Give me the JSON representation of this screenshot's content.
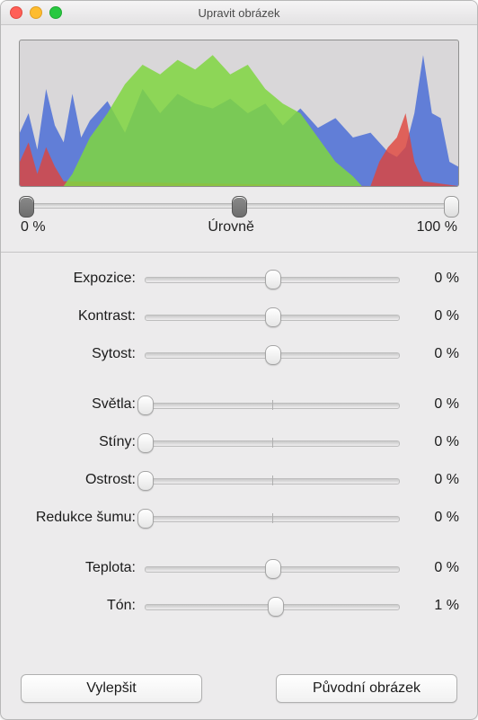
{
  "window": {
    "title": "Upravit obrázek"
  },
  "levels": {
    "left_label": "0 %",
    "center_label": "Úrovně",
    "right_label": "100 %"
  },
  "group1": [
    {
      "label": "Expozice:",
      "value": "0 %",
      "pos": 50,
      "type": "center"
    },
    {
      "label": "Kontrast:",
      "value": "0 %",
      "pos": 50,
      "type": "center"
    },
    {
      "label": "Sytost:",
      "value": "0 %",
      "pos": 50,
      "type": "center"
    }
  ],
  "group2": [
    {
      "label": "Světla:",
      "value": "0 %",
      "pos": 0,
      "type": "left"
    },
    {
      "label": "Stíny:",
      "value": "0 %",
      "pos": 0,
      "type": "left"
    },
    {
      "label": "Ostrost:",
      "value": "0 %",
      "pos": 0,
      "type": "left"
    },
    {
      "label": "Redukce šumu:",
      "value": "0 %",
      "pos": 0,
      "type": "left"
    }
  ],
  "group3": [
    {
      "label": "Teplota:",
      "value": "0 %",
      "pos": 50,
      "type": "center"
    },
    {
      "label": "Tón:",
      "value": "1 %",
      "pos": 51,
      "type": "center"
    }
  ],
  "buttons": {
    "enhance": "Vylepšit",
    "reset": "Původní obrázek"
  }
}
